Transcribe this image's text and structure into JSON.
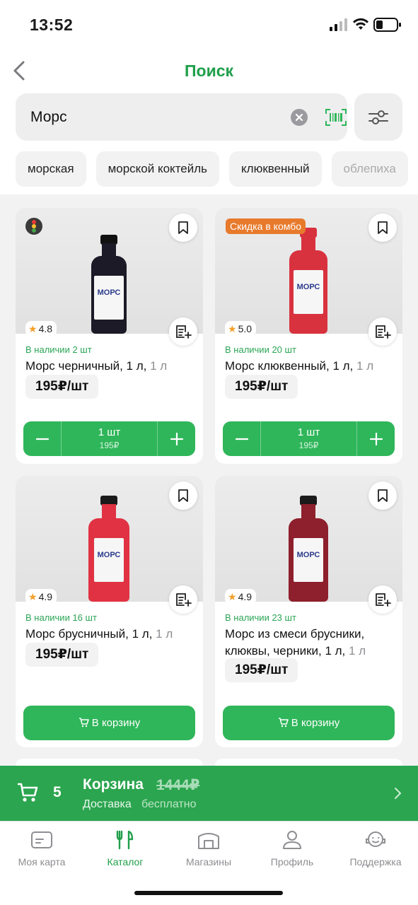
{
  "status_bar": {
    "time": "13:52"
  },
  "header": {
    "title": "Поиск",
    "search_value": "Морс",
    "chips": [
      "морская",
      "морской коктейль",
      "клюквенный",
      "облепиха"
    ]
  },
  "products": [
    {
      "name": "Морс черничный, 1 л,",
      "weight": "1 л",
      "rating": "4.8",
      "stock": "В наличии 2 шт",
      "price": "195₽/шт",
      "qty": "1 шт",
      "sum": "195₽",
      "liquid": "#1b1a26"
    },
    {
      "name": "Морс клюквенный, 1 л,",
      "weight": "1 л",
      "rating": "5.0",
      "stock": "В наличии 20 шт",
      "price": "195₽/шт",
      "qty": "1 шт",
      "sum": "195₽",
      "badge": "Скидка в комбо",
      "liquid": "#d8323f"
    },
    {
      "name": "Морс брусничный, 1 л,",
      "weight": "1 л",
      "rating": "4.9",
      "stock": "В наличии 16 шт",
      "price": "195₽/шт",
      "cart_label": "В корзину",
      "liquid": "#e03242"
    },
    {
      "name": "Морс из смеси брусники, клюквы, черники, 1 л,",
      "weight": "1 л",
      "rating": "4.9",
      "stock": "В наличии 23 шт",
      "price": "195₽/шт",
      "cart_label": "В корзину",
      "liquid": "#8e1f2c"
    }
  ],
  "label_text": "МОРС",
  "cart": {
    "count": "5",
    "title": "Корзина",
    "old_total": "1444₽",
    "delivery_label": "Доставка",
    "delivery_value": "бесплатно"
  },
  "tabs": [
    {
      "label": "Моя карта",
      "icon": "card-icon"
    },
    {
      "label": "Каталог",
      "icon": "cutlery-icon",
      "active": true
    },
    {
      "label": "Магазины",
      "icon": "store-icon"
    },
    {
      "label": "Профиль",
      "icon": "profile-icon"
    },
    {
      "label": "Поддержка",
      "icon": "support-icon"
    }
  ],
  "colors": {
    "accent": "#2fb65a",
    "title_green": "#1f9f4a",
    "badge_orange": "#e87a2c"
  }
}
